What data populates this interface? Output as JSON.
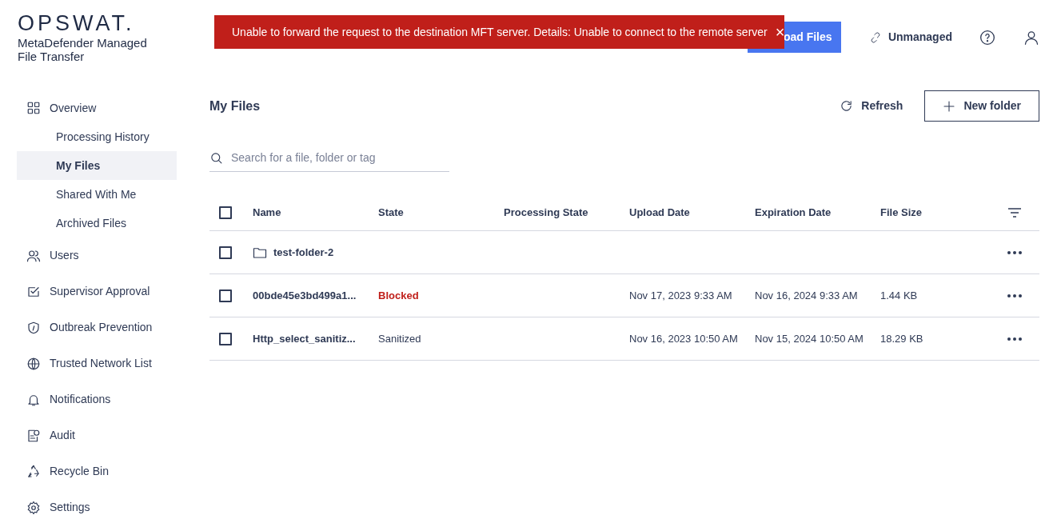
{
  "brand": {
    "logo": "OPSWAT.",
    "product": "MetaDefender Managed File Transfer"
  },
  "toast": {
    "message": "Unable to forward the request to the destination MFT server. Details: Unable to connect to the remote server",
    "close": "×"
  },
  "header": {
    "upload_button": "oad Files",
    "status": "Unmanaged"
  },
  "sidebar": {
    "items": [
      {
        "label": "Overview",
        "selected": false,
        "children": [
          {
            "label": "Processing History",
            "selected": false
          },
          {
            "label": "My Files",
            "selected": true
          },
          {
            "label": "Shared With Me",
            "selected": false
          },
          {
            "label": "Archived Files",
            "selected": false
          }
        ]
      },
      {
        "label": "Users",
        "selected": false
      },
      {
        "label": "Supervisor Approval",
        "selected": false
      },
      {
        "label": "Outbreak Prevention",
        "selected": false
      },
      {
        "label": "Trusted Network List",
        "selected": false
      },
      {
        "label": "Notifications",
        "selected": false
      },
      {
        "label": "Audit",
        "selected": false
      },
      {
        "label": "Recycle Bin",
        "selected": false
      },
      {
        "label": "Settings",
        "selected": false
      }
    ]
  },
  "page": {
    "title": "My Files",
    "refresh": "Refresh",
    "new_folder": "New folder",
    "search": {
      "placeholder": "Search for a file, folder or tag"
    }
  },
  "table": {
    "select_all_checked": false,
    "columns": [
      "Name",
      "State",
      "Processing State",
      "Upload Date",
      "Expiration Date",
      "File Size"
    ],
    "rows": [
      {
        "kind": "folder",
        "checked": false,
        "name": "test-folder-2"
      },
      {
        "kind": "file",
        "checked": false,
        "name": "00bde45e3bd499a1...",
        "state": "Blocked",
        "color": "#c01f1a",
        "upload_date": "Nov 17, 2023 9:33 AM",
        "expiration_date": "Nov 16, 2024 9:33 AM",
        "file_size": "1.44 KB"
      },
      {
        "kind": "file",
        "checked": false,
        "name": "Http_select_sanitiz...",
        "state": "Sanitized",
        "color": "#2f3a55",
        "upload_date": "Nov 16, 2023 10:50 AM",
        "expiration_date": "Nov 15, 2024 10:50 AM",
        "file_size": "18.29 KB"
      }
    ]
  }
}
